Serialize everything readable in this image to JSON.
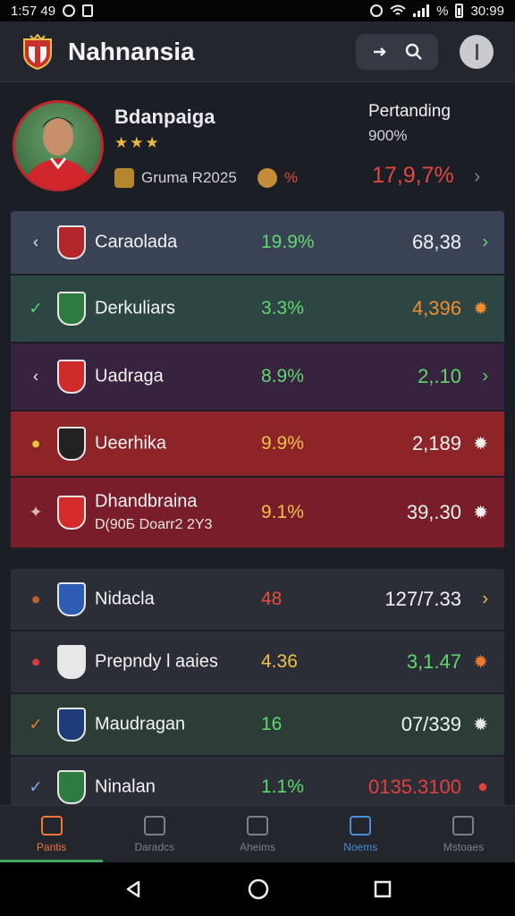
{
  "status": {
    "time_left": "1:57 49",
    "time_right": "30:99",
    "battery_label": "%"
  },
  "app": {
    "title": "Nahnansia"
  },
  "profile": {
    "name": "Bdanpaiga",
    "stars": "★★★",
    "club": "Gruma R2025",
    "tag": "%",
    "stat_label": "Pertanding",
    "stat_sub": "900%",
    "stat_value": "17,9,7%",
    "stat_chevron": "›"
  },
  "list1": [
    {
      "lead": "‹",
      "name": "Caraolada",
      "pct": "19.9%",
      "value": "68,38",
      "trail": "›",
      "bg": "#3a4256",
      "pct_color": "#5ed86c",
      "trail_color": "#5ed86c",
      "lead_color": "#e7e7e7",
      "crest_color": "#b3262a"
    },
    {
      "lead": "✓",
      "name": "Derkuliars",
      "pct": "3.3%",
      "value": "4,396",
      "trail": "✹",
      "bg": "#2d4543",
      "pct_color": "#5ed86c",
      "trail_color": "#ef8d2f",
      "lead_color": "#5ed86c",
      "crest_color": "#2f7a3e",
      "value_color": "#ef8d2f"
    },
    {
      "lead": "‹",
      "name": "Uadraga",
      "pct": "8.9%",
      "value": "2,.10",
      "trail": "›",
      "bg": "#37223f",
      "pct_color": "#5ed86c",
      "trail_color": "#5ed86c",
      "lead_color": "#f0f0f0",
      "crest_color": "#cf2b2b",
      "value_color": "#5ed86c"
    },
    {
      "lead": "●",
      "name": "Ueerhika",
      "pct": "9.9%",
      "value": "2,189",
      "trail": "✹",
      "bg": "#8c2428",
      "pct_color": "#f1c04c",
      "trail_color": "#f0f0f0",
      "lead_color": "#e8c238",
      "crest_color": "#222222"
    },
    {
      "lead": "✦",
      "name": "Dhandbraina",
      "name2": "D(90Б Doarr2 2Y3",
      "pct": "9.1%",
      "value": "39,.30",
      "trail": "✹",
      "bg": "#7a1d2a",
      "pct_color": "#f1c04c",
      "trail_color": "#f0f0f0",
      "lead_color": "#d9b7b7",
      "crest_color": "#d42b2b"
    }
  ],
  "list2": [
    {
      "lead": "●",
      "name": "Nidacla",
      "pct": "48",
      "value": "127/7.33",
      "trail": "›",
      "bg": "#2b2e36",
      "pct_color": "#e4503b",
      "trail_color": "#f1c04c",
      "lead_color": "#c0622c",
      "crest_color": "#2d5db3"
    },
    {
      "lead": "●",
      "name": "Prepndy l aaies",
      "pct": "4.36",
      "value": "3,1.47",
      "trail": "✹",
      "bg": "#2b2e36",
      "pct_color": "#f1c04c",
      "trail_color": "#ef7a2f",
      "lead_color": "#d93b3b",
      "crest_color": "#e8e8e8",
      "value_color": "#5ed86c"
    },
    {
      "lead": "✓",
      "name": "Maudragan",
      "pct": "16",
      "value": "07/339",
      "trail": "✹",
      "bg": "#2c3d38",
      "pct_color": "#5ed86c",
      "trail_color": "#e8e8e8",
      "lead_color": "#ef7a2f",
      "crest_color": "#1f3c7a"
    },
    {
      "lead": "✓",
      "name": "Ninalan",
      "pct": "1.1%",
      "value": "0135.3100",
      "trail": "●",
      "bg": "#2b2e36",
      "pct_color": "#5ed86c",
      "trail_color": "#e2403a",
      "lead_color": "#7fb2e8",
      "crest_color": "#2f7a3e",
      "value_color": "#e2403a"
    }
  ],
  "nav": [
    {
      "label": "Pantis",
      "icon": "home-icon",
      "state": "active"
    },
    {
      "label": "Daradcs",
      "icon": "building-icon",
      "state": ""
    },
    {
      "label": "Aheims",
      "icon": "person-icon",
      "state": ""
    },
    {
      "label": "Noems",
      "icon": "chart-icon",
      "state": "blue"
    },
    {
      "label": "Mstoaes",
      "icon": "shirt-icon",
      "state": ""
    }
  ]
}
